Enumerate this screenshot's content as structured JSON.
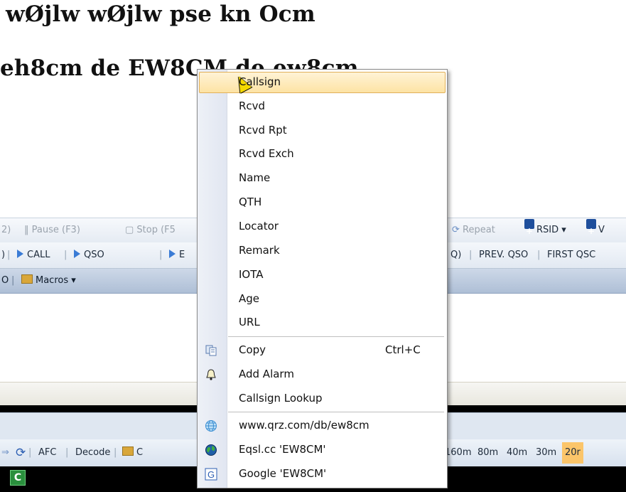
{
  "rx_text": {
    "line1": "wØjlw wØjlw pse kn Ocm",
    "line2": "eh8cm de EW8CM de ew8cm"
  },
  "toolbar1": {
    "frag_left": "2)",
    "pause": "Pause (F3)",
    "stop": "Stop (F5",
    "repeat": "Repeat",
    "rsid": "RSID ▾",
    "right_frag": "V"
  },
  "toolbar2": {
    "frag_left": ")",
    "call": "CALL",
    "qso": "QSO",
    "b_frag": "E",
    "right_frag": "Q)",
    "prev_qso": "PREV. QSO",
    "first_qso": "FIRST QSC"
  },
  "toolbar3": {
    "frag_left": "O",
    "macros": "Macros ▾"
  },
  "status_bar": {
    "afc": "AFC",
    "decode": "Decode",
    "c_frag": "C",
    "bands": [
      "160m",
      "80m",
      "40m",
      "30m",
      "20r"
    ],
    "active_band": "20r"
  },
  "green_indicator": "C",
  "context_menu": {
    "items": [
      {
        "label": "Callsign",
        "icon": "",
        "highlighted": true
      },
      {
        "label": "Rcvd",
        "icon": ""
      },
      {
        "label": "Rcvd Rpt",
        "icon": ""
      },
      {
        "label": "Rcvd Exch",
        "icon": ""
      },
      {
        "label": "Name",
        "icon": ""
      },
      {
        "label": "QTH",
        "icon": ""
      },
      {
        "label": "Locator",
        "icon": ""
      },
      {
        "label": "Remark",
        "icon": ""
      },
      {
        "label": "IOTA",
        "icon": ""
      },
      {
        "label": "Age",
        "icon": ""
      },
      {
        "label": "URL",
        "icon": ""
      }
    ],
    "edit_items": [
      {
        "label": "Copy",
        "shortcut": "Ctrl+C",
        "icon": "copy-icon"
      },
      {
        "label": "Add Alarm",
        "icon": "bell-icon"
      },
      {
        "label": "Callsign Lookup",
        "icon": ""
      }
    ],
    "web_items": [
      {
        "label": "www.qrz.com/db/ew8cm",
        "icon": "globe-grid-icon"
      },
      {
        "label": "Eqsl.cc 'EW8CM'",
        "icon": "earth-icon"
      },
      {
        "label": "Google 'EW8CM'",
        "icon": "google-icon"
      }
    ]
  },
  "colors": {
    "highlight": "#fde3a4",
    "menu_gutter": "#e1e6f1",
    "active_band": "#fbc56a"
  }
}
